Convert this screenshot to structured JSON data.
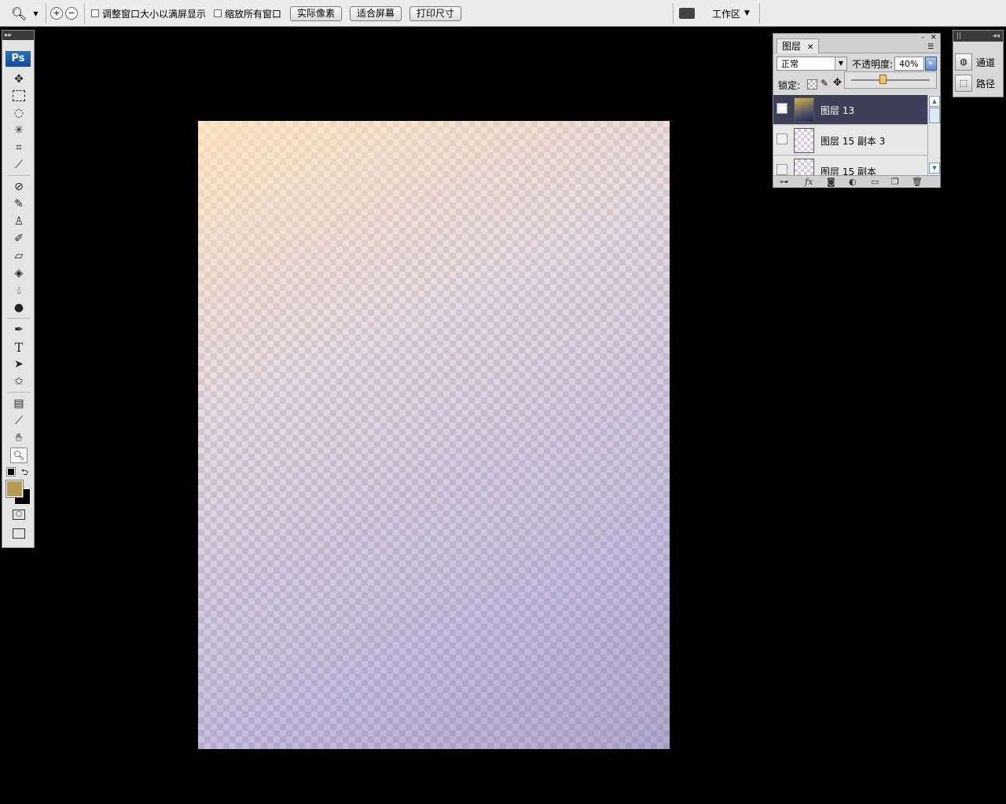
{
  "options_bar": {
    "fit_window_label": "调整窗口大小以满屏显示",
    "zoom_all_label": "缩放所有窗口",
    "actual_pixels": "实际像素",
    "fit_screen": "适合屏幕",
    "print_size": "打印尺寸",
    "workspace": "工作区"
  },
  "toolbox": {
    "logo": "Ps",
    "foreground_color": "#b39c52",
    "background_color": "#000000"
  },
  "layers_panel": {
    "tab_label": "图层",
    "blend_mode": "正常",
    "opacity_label": "不透明度:",
    "opacity_value": "40%",
    "lock_label": "锁定:",
    "layers": [
      {
        "name": "图层 13",
        "visible": true,
        "selected": true
      },
      {
        "name": "图层 15 副本 3",
        "visible": false,
        "selected": false
      },
      {
        "name": "图层 15 副本",
        "visible": false,
        "selected": false
      }
    ]
  },
  "side_panel": {
    "channels": "通道",
    "paths": "路径"
  }
}
